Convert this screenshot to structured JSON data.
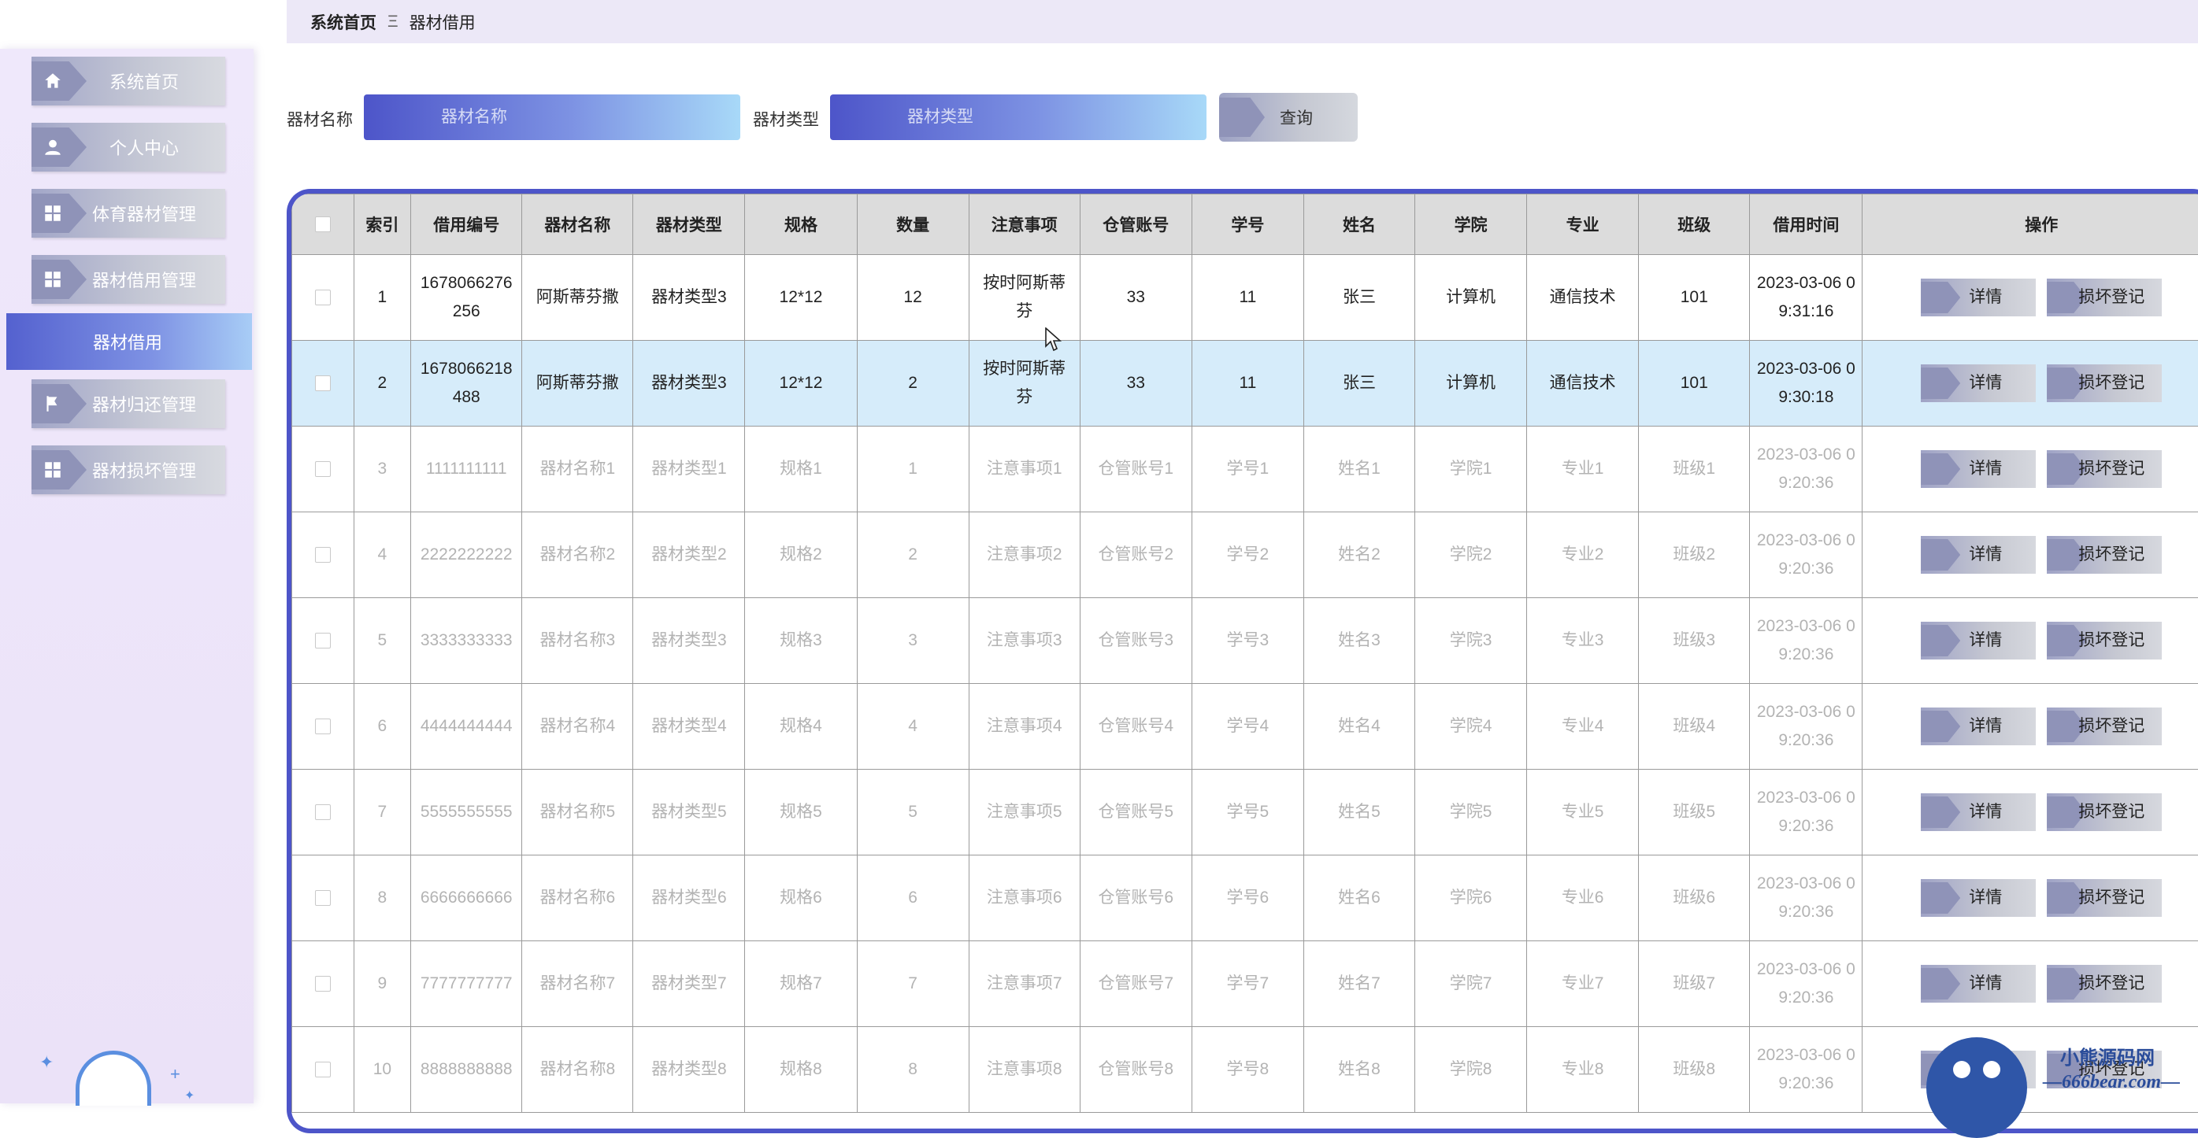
{
  "breadcrumb": {
    "home": "系统首页",
    "separator": "Ξ",
    "current": "器材借用"
  },
  "sidebar": {
    "items": [
      {
        "label": "系统首页",
        "icon": "home-icon"
      },
      {
        "label": "个人中心",
        "icon": "user-icon"
      },
      {
        "label": "体育器材管理",
        "icon": "grid-icon"
      },
      {
        "label": "器材借用管理",
        "icon": "grid-icon"
      },
      {
        "label": "器材借用"
      },
      {
        "label": "器材归还管理",
        "icon": "flag-icon"
      },
      {
        "label": "器材损坏管理",
        "icon": "grid-icon"
      }
    ]
  },
  "search": {
    "name_label": "器材名称",
    "name_placeholder": "器材名称",
    "type_label": "器材类型",
    "type_placeholder": "器材类型",
    "query_label": "查询"
  },
  "table": {
    "headers": [
      "",
      "索引",
      "借用编号",
      "器材名称",
      "器材类型",
      "规格",
      "数量",
      "注意事项",
      "仓管账号",
      "学号",
      "姓名",
      "学院",
      "专业",
      "班级",
      "借用时间",
      "操作"
    ],
    "detail_label": "详情",
    "damage_label": "损坏登记",
    "rows": [
      [
        "1",
        "1678066276256",
        "阿斯蒂芬撒",
        "器材类型3",
        "12*12",
        "12",
        "按时阿斯蒂芬",
        "33",
        "11",
        "张三",
        "计算机",
        "通信技术",
        "101",
        "2023-03-06 09:31:16"
      ],
      [
        "2",
        "1678066218488",
        "阿斯蒂芬撒",
        "器材类型3",
        "12*12",
        "2",
        "按时阿斯蒂芬",
        "33",
        "11",
        "张三",
        "计算机",
        "通信技术",
        "101",
        "2023-03-06 09:30:18"
      ],
      [
        "3",
        "1111111111",
        "器材名称1",
        "器材类型1",
        "规格1",
        "1",
        "注意事项1",
        "仓管账号1",
        "学号1",
        "姓名1",
        "学院1",
        "专业1",
        "班级1",
        "2023-03-06 09:20:36"
      ],
      [
        "4",
        "2222222222",
        "器材名称2",
        "器材类型2",
        "规格2",
        "2",
        "注意事项2",
        "仓管账号2",
        "学号2",
        "姓名2",
        "学院2",
        "专业2",
        "班级2",
        "2023-03-06 09:20:36"
      ],
      [
        "5",
        "3333333333",
        "器材名称3",
        "器材类型3",
        "规格3",
        "3",
        "注意事项3",
        "仓管账号3",
        "学号3",
        "姓名3",
        "学院3",
        "专业3",
        "班级3",
        "2023-03-06 09:20:36"
      ],
      [
        "6",
        "4444444444",
        "器材名称4",
        "器材类型4",
        "规格4",
        "4",
        "注意事项4",
        "仓管账号4",
        "学号4",
        "姓名4",
        "学院4",
        "专业4",
        "班级4",
        "2023-03-06 09:20:36"
      ],
      [
        "7",
        "5555555555",
        "器材名称5",
        "器材类型5",
        "规格5",
        "5",
        "注意事项5",
        "仓管账号5",
        "学号5",
        "姓名5",
        "学院5",
        "专业5",
        "班级5",
        "2023-03-06 09:20:36"
      ],
      [
        "8",
        "6666666666",
        "器材名称6",
        "器材类型6",
        "规格6",
        "6",
        "注意事项6",
        "仓管账号6",
        "学号6",
        "姓名6",
        "学院6",
        "专业6",
        "班级6",
        "2023-03-06 09:20:36"
      ],
      [
        "9",
        "7777777777",
        "器材名称7",
        "器材类型7",
        "规格7",
        "7",
        "注意事项7",
        "仓管账号7",
        "学号7",
        "姓名7",
        "学院7",
        "专业7",
        "班级7",
        "2023-03-06 09:20:36"
      ],
      [
        "10",
        "8888888888",
        "器材名称8",
        "器材类型8",
        "规格8",
        "8",
        "注意事项8",
        "仓管账号8",
        "学号8",
        "姓名8",
        "学院8",
        "专业8",
        "班级8",
        "2023-03-06 09:20:36"
      ]
    ]
  },
  "watermark": {
    "title": "小熊源码网",
    "url": "—666bear.com—"
  },
  "colors": {
    "accent": "#4d55c9",
    "header_bg": "#dcdcdc",
    "hover_row": "#d6ecfa",
    "sidebar_bg": "#efe8fb"
  }
}
